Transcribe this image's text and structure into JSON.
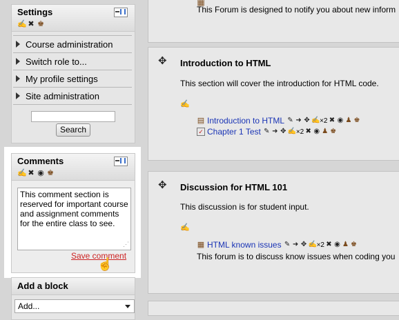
{
  "settings": {
    "title": "Settings",
    "items": [
      {
        "label": "Course administration"
      },
      {
        "label": "Switch role to..."
      },
      {
        "label": "My profile settings"
      },
      {
        "label": "Site administration"
      }
    ],
    "search_value": "",
    "search_button": "Search"
  },
  "comments": {
    "title": "Comments",
    "text": "This comment section is reserved for important course and assignment comments for the entire class to see.",
    "save_label": "Save comment"
  },
  "add_block": {
    "title": "Add a block",
    "select_value": "Add..."
  },
  "top_section": {
    "description": "This Forum is designed to notify you about new inform"
  },
  "section_html": {
    "title": "Introduction to HTML",
    "description": "This section will cover the introduction for HTML code.",
    "activities": [
      {
        "label": "Introduction to HTML",
        "group_mode": "×2"
      },
      {
        "label": "Chapter 1 Test",
        "group_mode": "×2"
      }
    ]
  },
  "section_discussion": {
    "title": "Discussion for HTML 101",
    "description": "This discussion is for student input.",
    "activities": [
      {
        "label": "HTML known issues",
        "group_mode": "×2"
      }
    ],
    "forum_description": "This forum is to discuss know issues when coding you"
  },
  "colors": {
    "link": "#1a34b5",
    "save_link": "#cc2222",
    "highlight_panel": "#ffffff",
    "page_background": "#d6d6d6"
  }
}
